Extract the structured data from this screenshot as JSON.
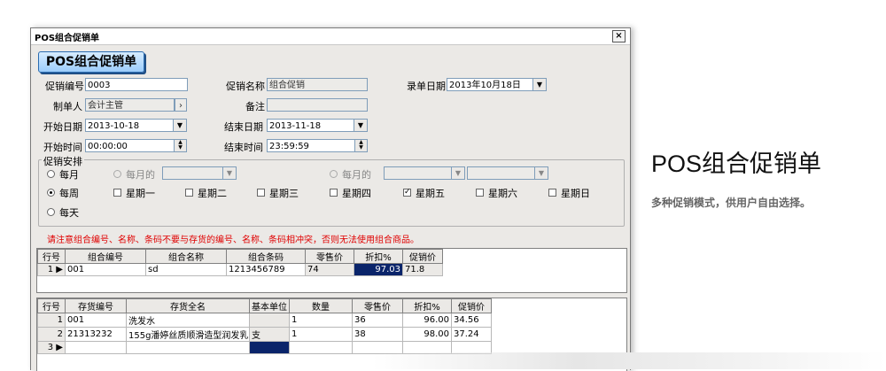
{
  "window": {
    "title": "POS组合促销单",
    "close_glyph": "×",
    "banner": "POS组合促销单"
  },
  "form": {
    "promo_no_label": "促销编号",
    "promo_no_value": "0003",
    "promo_name_label": "促销名称",
    "promo_name_value": "组合促销",
    "entry_date_label": "录单日期",
    "entry_date_value": "2013年10月18日",
    "maker_label": "制单人",
    "maker_value": "会计主管",
    "maker_btn": "›",
    "remark_label": "备注",
    "remark_value": "",
    "start_date_label": "开始日期",
    "start_date_value": "2013-10-18",
    "end_date_label": "结束日期",
    "end_date_value": "2013-11-18",
    "start_time_label": "开始时间",
    "start_time_value": "00:00:00",
    "end_time_label": "结束时间",
    "end_time_value": "23:59:59"
  },
  "schedule": {
    "title": "促销安排",
    "monthly": "每月",
    "monthly_of_1": "每月的",
    "monthly_of_2": "每月的",
    "weekly": "每周",
    "daily": "每天",
    "weekdays": [
      {
        "label": "星期一",
        "checked": false
      },
      {
        "label": "星期二",
        "checked": false
      },
      {
        "label": "星期三",
        "checked": false
      },
      {
        "label": "星期四",
        "checked": false
      },
      {
        "label": "星期五",
        "checked": true
      },
      {
        "label": "星期六",
        "checked": false
      },
      {
        "label": "星期日",
        "checked": false
      }
    ],
    "check_mark": "✓"
  },
  "warning": "请注意组合编号、名称、条码不要与存货的编号、名称、条码相冲突，否则无法使用组合商品。",
  "combo_table": {
    "headers": [
      "行号",
      "组合编号",
      "组合名称",
      "组合条码",
      "零售价",
      "折扣%",
      "促销价"
    ],
    "rows": [
      {
        "no": "1",
        "code": "001",
        "name": "sd",
        "barcode": "1213456789",
        "price": "74",
        "discount": "97.03",
        "promo": "71.8"
      }
    ]
  },
  "item_table": {
    "headers": [
      "行号",
      "存货编号",
      "存货全名",
      "基本单位",
      "数量",
      "零售价",
      "折扣%",
      "促销价"
    ],
    "rows": [
      {
        "no": "1",
        "code": "001",
        "name": "洗发水",
        "unit": "",
        "qty": "1",
        "price": "36",
        "discount": "96.00",
        "promo": "34.56"
      },
      {
        "no": "2",
        "code": "21313232",
        "name": "155g潘婷丝质顺滑造型润发乳",
        "unit": "支",
        "qty": "1",
        "price": "38",
        "discount": "98.00",
        "promo": "37.24"
      },
      {
        "no": "3",
        "code": "",
        "name": "",
        "unit": "",
        "qty": "",
        "price": "",
        "discount": "",
        "promo": ""
      }
    ]
  },
  "side": {
    "title": "POS组合促销单",
    "subtitle": "多种促销模式，供用户自由选择。"
  },
  "icons": {
    "dropdown": "▼",
    "row_pointer": "▶",
    "spin_up": "▲",
    "spin_down": "▼"
  },
  "colors": {
    "selection": "#0a246a",
    "warning_text": "#e00000",
    "banner_fill": "#9ccdfb"
  }
}
